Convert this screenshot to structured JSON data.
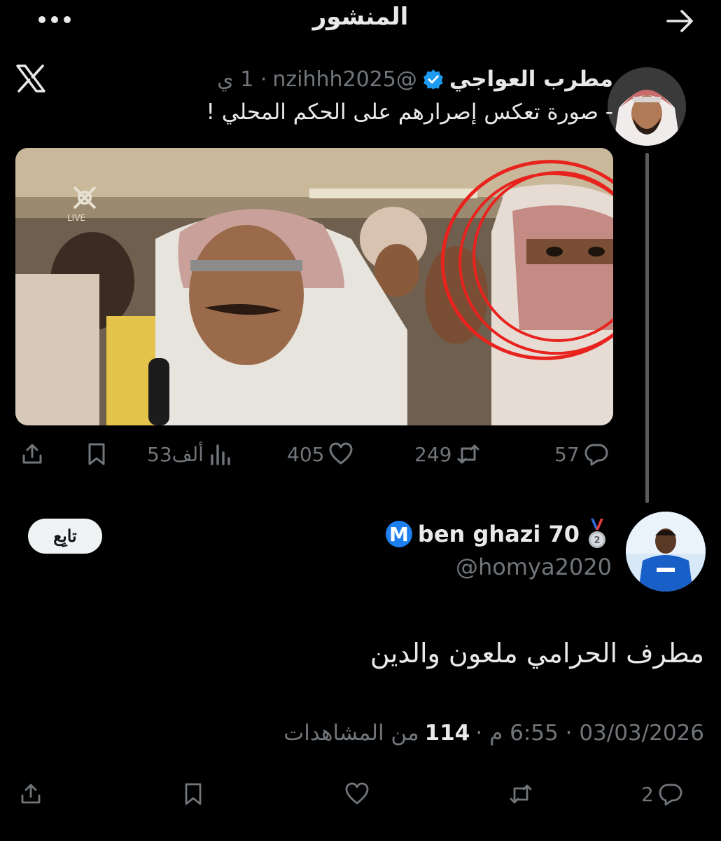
{
  "header": {
    "title": "المنشور"
  },
  "post": {
    "author_name": "مطرب العواجي",
    "handle": "@nzihhh2025",
    "time": "· 1 ي",
    "text": "- صورة تعكس إصرارهم على الحكم المحلي  !",
    "media_watermark": "LIVE",
    "stats": {
      "replies": "57",
      "reposts": "249",
      "likes": "405",
      "views": "53ألف"
    }
  },
  "reply": {
    "display_name": "ben ghazi 70",
    "badge_letter": "M",
    "handle": "@homya2020",
    "follow_label": "تابِع",
    "text": "مطرف الحرامي ملعون والدين",
    "date": "03/03/2026 · 6:55 م ·",
    "views_count": "114",
    "views_label": "من المشاهدات",
    "stats": {
      "replies": "2"
    }
  },
  "colors": {
    "background": "#000000",
    "text": "#e7e9ea",
    "muted": "#71767b",
    "verified": "#1d9bf0",
    "annotation": "#e8231e"
  }
}
